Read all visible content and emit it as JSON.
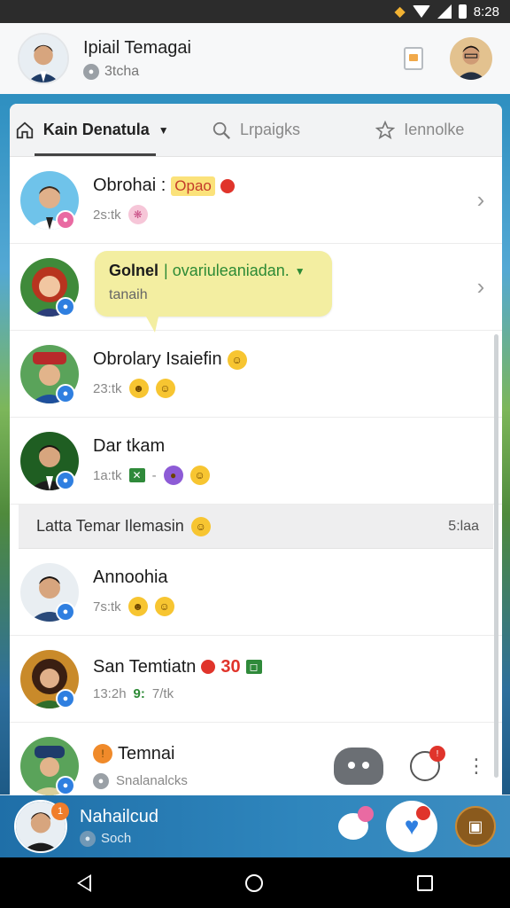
{
  "status_bar": {
    "time": "8:28"
  },
  "header": {
    "name": "Ipiail Temagai",
    "subtitle": "3tcha",
    "icons": [
      "person-avatar",
      "document-icon",
      "contact-avatar"
    ]
  },
  "tabs": [
    {
      "label": "Kain Denatula",
      "icon": "home-icon",
      "active": true
    },
    {
      "label": "Lrpaigks",
      "icon": "search-icon",
      "active": false
    },
    {
      "label": "Iennolke",
      "icon": "star-icon",
      "active": false
    }
  ],
  "rows": [
    {
      "name": "Obrohai :",
      "tag": "Opao",
      "meta": "2s:tk"
    },
    {
      "name": "",
      "meta": ""
    },
    {
      "name": "Obrolary Isaiefin",
      "meta": "23:tk"
    },
    {
      "name": "Dar tkam",
      "meta": "1a:tk"
    }
  ],
  "bubble": {
    "title_bold": "Golnel",
    "title_green": "| ovariuleaniadan.",
    "subtitle": "tanaih"
  },
  "section": {
    "title": "Latta Temar Ilemasin",
    "right": "5:laa"
  },
  "rows2": [
    {
      "name": "Annoohia",
      "meta": "7s:tk"
    },
    {
      "name": "San Temtiatn",
      "badge_num": "30",
      "meta": "13:2h",
      "meta_green": "9:",
      "meta_extra": "7/tk"
    },
    {
      "name": "Temnai",
      "meta": "Snalanalcks"
    }
  ],
  "bottom_bar": {
    "name": "Nahailcud",
    "sub": "Soch",
    "badge": "1"
  },
  "colors": {
    "accent_blue": "#2f7fe0",
    "badge_red": "#e0342b",
    "bubble_yellow": "#f3eea1",
    "green_text": "#2c8a35"
  }
}
